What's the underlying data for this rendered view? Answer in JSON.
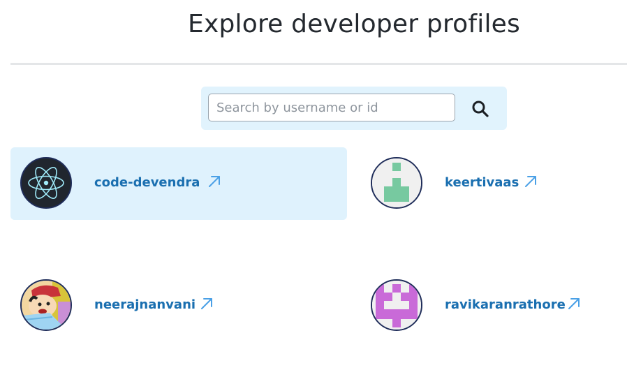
{
  "header": {
    "title": "Explore developer profiles"
  },
  "search": {
    "placeholder": "Search by username or id",
    "value": "",
    "button_icon": "search-icon"
  },
  "profiles": [
    {
      "username": "code-devendra",
      "avatar_icon": "electron-logo-avatar",
      "highlighted": true,
      "link_icon": "external-link-icon"
    },
    {
      "username": "keertivaas",
      "avatar_icon": "identicon-green-avatar",
      "highlighted": false,
      "link_icon": "external-link-icon"
    },
    {
      "username": "neerajnanvani",
      "avatar_icon": "cartoon-character-avatar",
      "highlighted": false,
      "link_icon": "external-link-icon"
    },
    {
      "username": "ravikaranrathore",
      "avatar_icon": "identicon-purple-avatar",
      "highlighted": false,
      "link_icon": "external-link-icon"
    }
  ],
  "colors": {
    "highlight_bg": "#dff2fd",
    "search_bar_bg": "#e1f3fd",
    "username_link": "#1a6fb0",
    "arrow_icon": "#4aa0e6",
    "avatar_border": "#1f2d5a"
  }
}
